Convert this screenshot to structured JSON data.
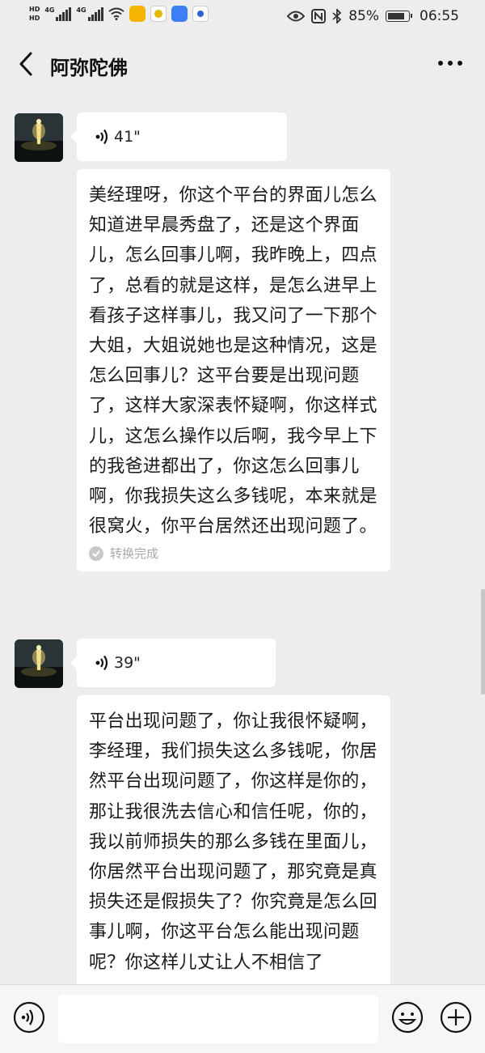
{
  "status_bar": {
    "hd_label": "HD",
    "network_1": "4G",
    "network_2": "4G",
    "battery_percent": 85,
    "battery_text": "85%",
    "time": "06:55"
  },
  "header": {
    "title": "阿弥陀佛"
  },
  "messages": [
    {
      "voice_length": "41\"",
      "transcript": "美经理呀，你这个平台的界面儿怎么知道进早晨秀盘了，还是这个界面儿，怎么回事儿啊，我昨晚上，四点了，总看的就是这样，是怎么进早上看孩子这样事儿，我又问了一下那个大姐，大姐说她也是这种情况，这是怎么回事儿？这平台要是出现问题了，这样大家深表怀疑啊，你这样式儿，这怎么操作以后啊，我今早上下的我爸进都出了，你这怎么回事儿啊，你我损失这么多钱呢，本来就是很窝火，你平台居然还出现问题了。",
      "status": "转换完成"
    },
    {
      "voice_length": "39\"",
      "transcript": "平台出现问题了，你让我很怀疑啊，李经理，我们损失这么多钱呢，你居然平台出现问题了，你这样是你的，那让我很洗去信心和信任呢，你的，我以前师损失的那么多钱在里面儿，你居然平台出现问题了，那究竟是真损失还是假损失了？你究竟是怎么回事儿啊，你这平台怎么能出现问题呢？你这样儿丈让人不相信了"
    }
  ],
  "input_bar": {
    "value": ""
  },
  "colors": {
    "background": "#ededed",
    "bubble": "#ffffff",
    "input_bar": "#f6f6f6"
  },
  "icons": [
    "back-arrow-icon",
    "more-dots-icon",
    "voice-wave-icon",
    "check-circle-icon",
    "voice-input-icon",
    "emoji-icon",
    "plus-icon"
  ]
}
